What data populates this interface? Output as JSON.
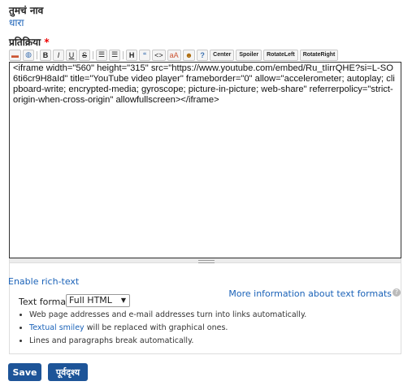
{
  "name_field": {
    "label": "तुमचं नाव",
    "value": "धारा"
  },
  "comment_field": {
    "label": "प्रतिक्रिया",
    "required_mark": "*"
  },
  "toolbar": {
    "buttons": [
      {
        "name": "image-icon",
        "label": "▬"
      },
      {
        "name": "globe-icon",
        "label": "◍"
      },
      {
        "name": "bold-button",
        "label": "B"
      },
      {
        "name": "italic-button",
        "label": "I"
      },
      {
        "name": "underline-button",
        "label": "U"
      },
      {
        "name": "strike-button",
        "label": "S"
      },
      {
        "name": "ordered-list-button",
        "label": "☰"
      },
      {
        "name": "unordered-list-button",
        "label": "☰"
      },
      {
        "name": "heading-button",
        "label": "H"
      },
      {
        "name": "quote-button",
        "label": "“"
      },
      {
        "name": "code-button",
        "label": "<>"
      },
      {
        "name": "font-size-button",
        "label": "aA"
      },
      {
        "name": "smiley-button",
        "label": "☻"
      },
      {
        "name": "help-button",
        "label": "?"
      }
    ],
    "text_buttons": [
      "Center",
      "Spoiler",
      "RotateLeft",
      "RotateRight"
    ]
  },
  "editor": {
    "content": "<iframe width=\"560\" height=\"315\" src=\"https://www.youtube.com/embed/Ru_tIirrQHE?si=L-SO6ti6cr9H8aId\" title=\"YouTube video player\" frameborder=\"0\" allow=\"accelerometer; autoplay; clipboard-write; encrypted-media; gyroscope; picture-in-picture; web-share\" referrerpolicy=\"strict-origin-when-cross-origin\" allowfullscreen></iframe>"
  },
  "format": {
    "enable_rich_text": "Enable rich-text",
    "more_info": "More information about text formats",
    "help_icon": "?",
    "label": "Text format",
    "selected": "Full HTML",
    "tips": [
      "Web page addresses and e-mail addresses turn into links automatically.",
      {
        "link": "Textual smiley",
        "text": " will be replaced with graphical ones."
      },
      "Lines and paragraphs break automatically."
    ]
  },
  "actions": {
    "save": "Save",
    "preview": "पूर्वदृश्य"
  }
}
